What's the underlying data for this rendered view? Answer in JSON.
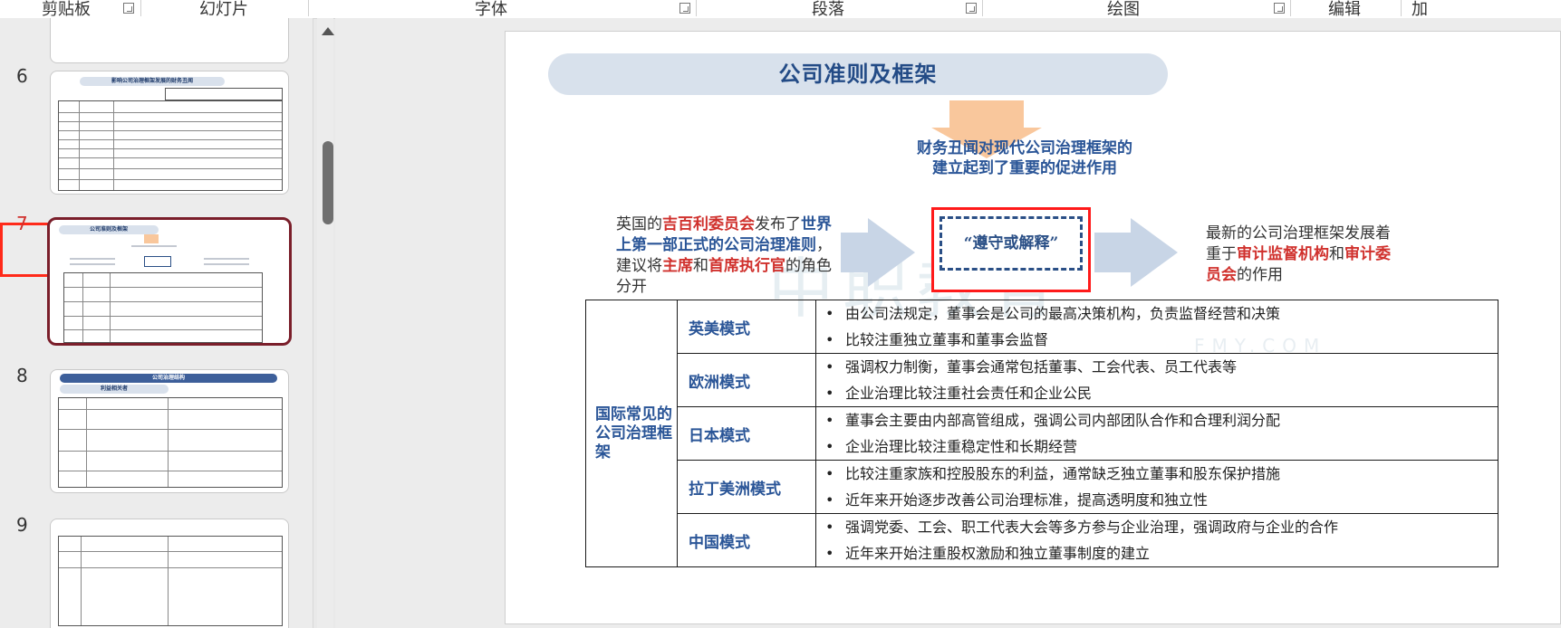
{
  "ribbon": {
    "groups": [
      "剪贴板",
      "幻灯片",
      "字体",
      "段落",
      "绘图",
      "编辑",
      "加"
    ]
  },
  "thumbnails": [
    {
      "number": "6",
      "title": "影响公司治理框架发展的财务丑闻"
    },
    {
      "number": "7",
      "title": "公司准则及框架",
      "selected": true
    },
    {
      "number": "8",
      "title": "公司治理结构",
      "subtitle": "利益相关者"
    },
    {
      "number": "9",
      "title": ""
    }
  ],
  "slide": {
    "title": "公司准则及框架",
    "promo_text": "财务丑闻对现代公司治理框架的建立起到了重要的促进作用",
    "uk_text": {
      "p1": "英国的",
      "cadbury": "吉百利委员会",
      "p2": "发布了",
      "code": "世界上第一部正式的公司治理准则",
      "p3": "，建议将",
      "chair": "主席",
      "p4": "和",
      "ceo": "首席执行官",
      "p5": "的角色分开"
    },
    "comply_text": "“遵守或解释”",
    "right_text": {
      "p1": "最新的公司治理框架发展着重于",
      "audit_agency": "审计监督机构",
      "p2": "和",
      "audit_committee": "审计委员会",
      "p3": "的作用"
    },
    "watermark": "中职教育",
    "watermark_sub": "FMY.COM",
    "table": {
      "category": "国际常见的公司治理框架",
      "rows": [
        {
          "model": "英美模式",
          "bullets": [
            "由公司法规定，董事会是公司的最高决策机构，负责监督经营和决策",
            "比较注重独立董事和董事会监督"
          ]
        },
        {
          "model": "欧洲模式",
          "bullets": [
            "强调权力制衡，董事会通常包括董事、工会代表、员工代表等",
            "企业治理比较注重社会责任和企业公民"
          ]
        },
        {
          "model": "日本模式",
          "bullets": [
            "董事会主要由内部高管组成，强调公司内部团队合作和合理利润分配",
            "企业治理比较注重稳定性和长期经营"
          ]
        },
        {
          "model": "拉丁美洲模式",
          "bullets": [
            "比较注重家族和控股股东的利益，通常缺乏独立董事和股东保护措施",
            "近年来开始逐步改善公司治理标准，提高透明度和独立性"
          ]
        },
        {
          "model": "中国模式",
          "bullets": [
            "强调党委、工会、职工代表大会等多方参与企业治理，强调政府与企业的合作",
            "近年来开始注重股权激励和独立董事制度的建立"
          ]
        }
      ]
    }
  },
  "colors": {
    "title_blue": "#234b86",
    "accent_red": "#d0312d",
    "selection_maroon": "#7a1e2a",
    "arrow_orange": "#f9c79c",
    "chevron_blue": "#c8d5e6",
    "highlight_red": "#ff1a1a"
  }
}
